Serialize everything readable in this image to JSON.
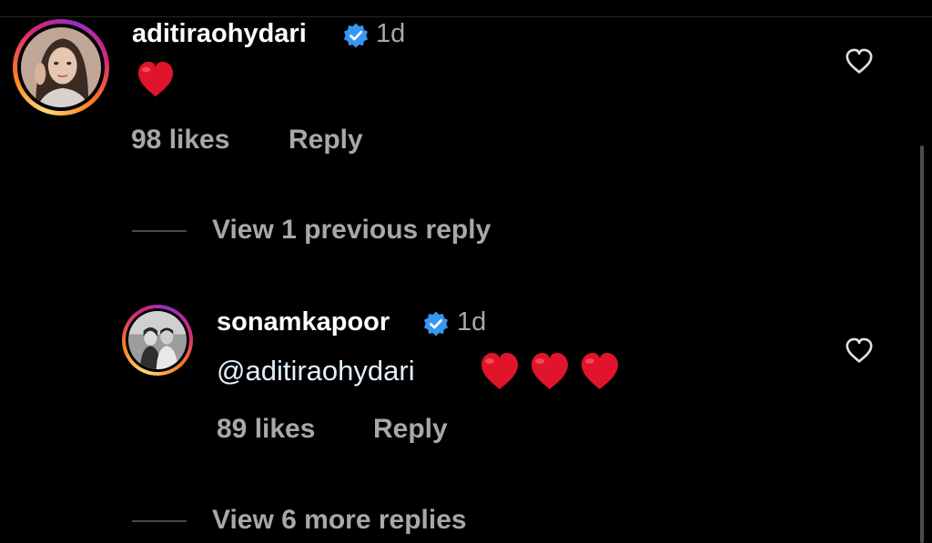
{
  "comments": [
    {
      "username": "aditiraohydari",
      "verified": true,
      "time": "1d",
      "text": "",
      "emoji": "❤️",
      "likes": "98 likes",
      "reply_label": "Reply"
    },
    {
      "username": "sonamkapoor",
      "verified": true,
      "time": "1d",
      "mention": "@aditiraohydari",
      "emoji": "❤️❤️❤️",
      "likes": "89 likes",
      "reply_label": "Reply"
    }
  ],
  "view_previous": "View 1 previous reply",
  "view_more": "View 6 more replies",
  "colors": {
    "background": "#000000",
    "secondary_text": "#a8a8a8",
    "verified_badge": "#3897f0",
    "heart": "#e0142a"
  }
}
